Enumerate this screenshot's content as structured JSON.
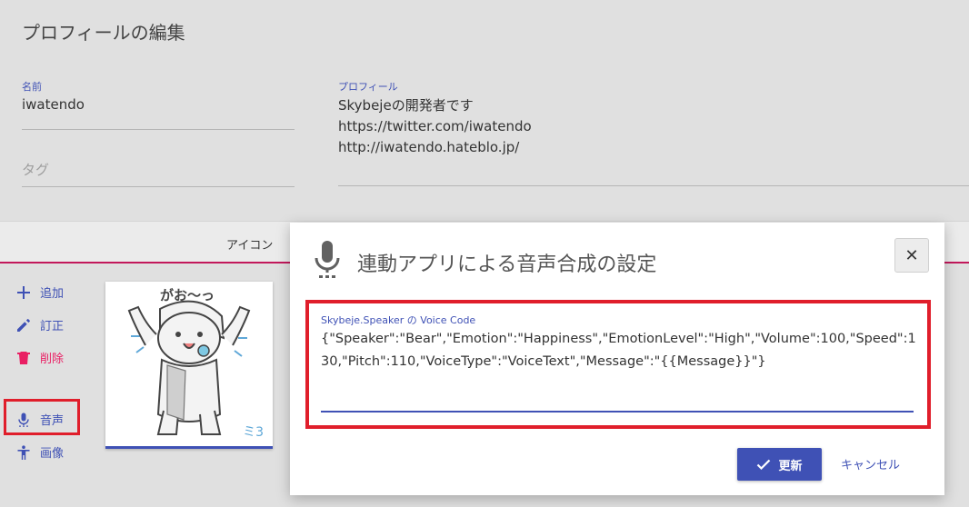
{
  "page": {
    "title": "プロフィールの編集"
  },
  "form": {
    "name_label": "名前",
    "name_value": "iwatendo",
    "tag_placeholder": "タグ",
    "profile_label": "プロフィール",
    "profile_lines": [
      "Skybejeの開発者です",
      "https://twitter.com/iwatendo",
      "http://iwatendo.hateblo.jp/"
    ]
  },
  "tabs": {
    "icon_tab": "アイコン"
  },
  "actions": {
    "add": "追加",
    "edit": "訂正",
    "delete": "削除",
    "voice": "音声",
    "image": "画像"
  },
  "icon_card": {
    "caption": "がお〜っ",
    "corner_text": "ミ3"
  },
  "dialog": {
    "title": "連動アプリによる音声合成の設定",
    "close_label": "✕",
    "code_label": "Skybeje.Speaker の Voice Code",
    "code_value": "{\"Speaker\":\"Bear\",\"Emotion\":\"Happiness\",\"EmotionLevel\":\"High\",\"Volume\":100,\"Speed\":130,\"Pitch\":110,\"VoiceType\":\"VoiceText\",\"Message\":\"{{Message}}\"}",
    "update_label": "更新",
    "cancel_label": "キャンセル"
  },
  "colors": {
    "primary": "#3f51b5",
    "accent": "#e91e63",
    "highlight": "#e01e2b"
  }
}
